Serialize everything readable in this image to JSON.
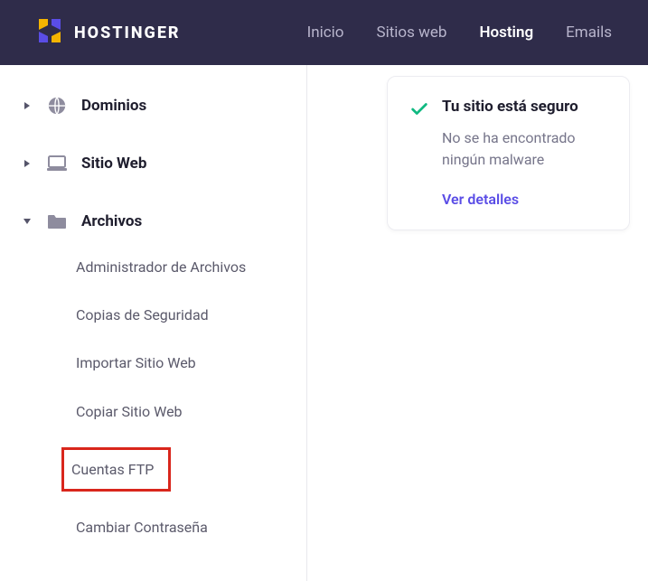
{
  "brand": "HOSTINGER",
  "nav": {
    "items": [
      {
        "label": "Inicio",
        "active": false
      },
      {
        "label": "Sitios web",
        "active": false
      },
      {
        "label": "Hosting",
        "active": true
      },
      {
        "label": "Emails",
        "active": false
      }
    ]
  },
  "sidebar": {
    "sections": [
      {
        "label": "Dominios",
        "expanded": false,
        "icon": "globe"
      },
      {
        "label": "Sitio Web",
        "expanded": false,
        "icon": "laptop"
      },
      {
        "label": "Archivos",
        "expanded": true,
        "icon": "folder",
        "items": [
          "Administrador de Archivos",
          "Copias de Seguridad",
          "Importar Sitio Web",
          "Copiar Sitio Web",
          "Cuentas FTP",
          "Cambiar Contraseña"
        ],
        "highlight_index": 4
      }
    ]
  },
  "card": {
    "title": "Tu sitio está seguro",
    "subtitle": "No se ha encontrado ningún malware",
    "link": "Ver detalles"
  }
}
